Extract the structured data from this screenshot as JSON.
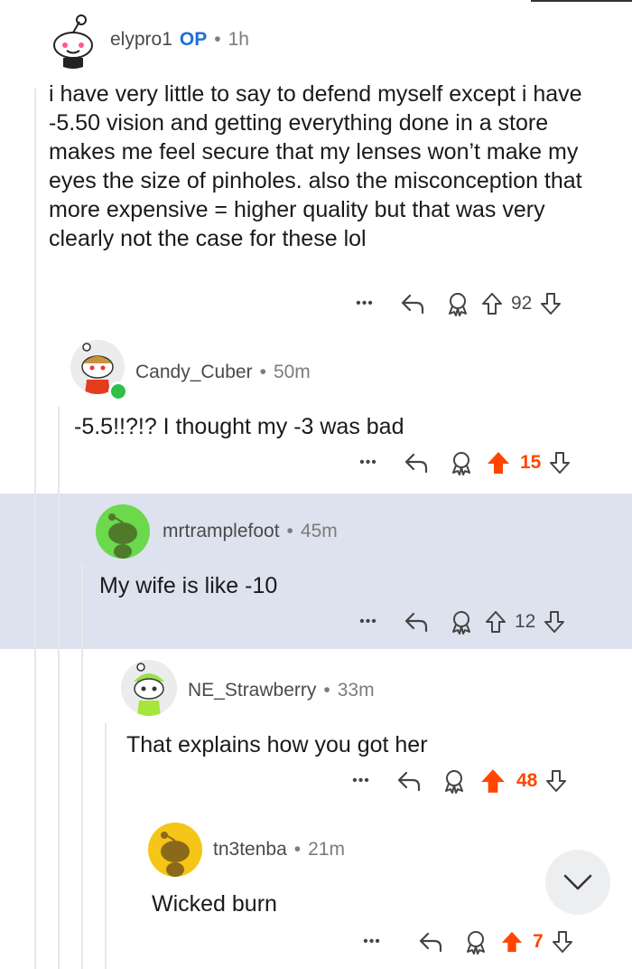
{
  "comments": [
    {
      "username": "elypro1",
      "op_label": "OP",
      "time": "1h",
      "body": "i have very little to say to defend myself except i have -5.50 vision and getting everything done in a store makes me feel secure that my lenses won’t make my eyes the size of pinholes. also the misconception that more expensive = higher quality but that was very clearly not the case for these lol",
      "votes": "92",
      "upvoted": false
    },
    {
      "username": "Candy_Cuber",
      "time": "50m",
      "body": "-5.5!!?!? I thought my -3 was bad",
      "votes": "15",
      "upvoted": true,
      "online": true
    },
    {
      "username": "mrtramplefoot",
      "time": "45m",
      "body": "My wife is like -10",
      "votes": "12",
      "upvoted": false,
      "highlighted": true
    },
    {
      "username": "NE_Strawberry",
      "time": "33m",
      "body": "That explains how you got her",
      "votes": "48",
      "upvoted": true
    },
    {
      "username": "tn3tenba",
      "time": "21m",
      "body": "Wicked burn",
      "votes": "7",
      "upvoted": true
    }
  ],
  "separator": "•",
  "more_label": "•••",
  "icons": {
    "reply": "reply-icon",
    "award": "award-icon",
    "upvote": "upvote-arrow-icon",
    "downvote": "downvote-arrow-icon",
    "collapse": "chevron-down-icon"
  },
  "colors": {
    "upvoted": "#ff4500",
    "op": "#1f6fd6",
    "highlight": "#dde2ee",
    "online": "#2fbf4a"
  }
}
